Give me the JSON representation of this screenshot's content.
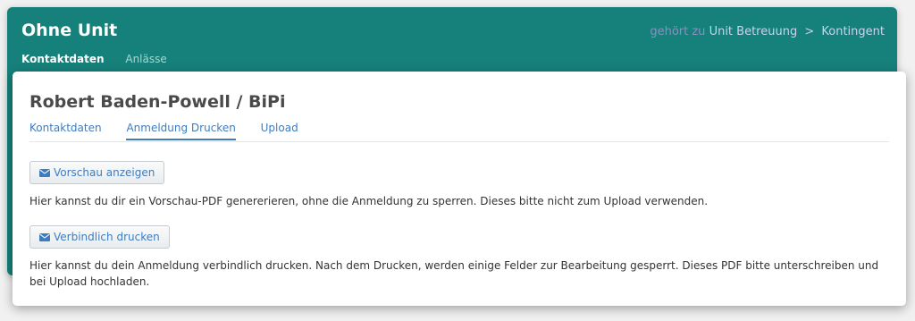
{
  "header": {
    "title": "Ohne Unit",
    "breadcrumb": {
      "prefix": "gehört zu",
      "items": [
        "Unit Betreuung",
        "Kontingent"
      ],
      "separator": ">"
    },
    "tabs": [
      {
        "label": "Kontaktdaten",
        "active": true
      },
      {
        "label": "Anlässe",
        "active": false
      }
    ]
  },
  "card": {
    "title": "Robert Baden-Powell / BiPi",
    "tabs": [
      {
        "label": "Kontaktdaten",
        "active": false
      },
      {
        "label": "Anmeldung Drucken",
        "active": true
      },
      {
        "label": "Upload",
        "active": false
      }
    ],
    "preview_button": {
      "label": "Vorschau anzeigen",
      "icon": "envelope-icon"
    },
    "preview_text": "Hier kannst du dir ein Vorschau-PDF genererieren, ohne die Anmeldung zu sperren. Dieses bitte nicht zum Upload verwenden.",
    "final_button": {
      "label": "Verbindlich drucken",
      "icon": "envelope-icon"
    },
    "final_text": "Hier kannst du dein Anmeldung verbindlich drucken. Nach dem Drucken, werden einige Felder zur Bearbeitung gesperrt. Dieses PDF bitte unterschreiben und bei Upload hochladen."
  },
  "colors": {
    "header_bg": "#16807a",
    "link": "#3e7cc0",
    "card_bg": "#ffffff",
    "page_bg": "#f1f1f1"
  }
}
